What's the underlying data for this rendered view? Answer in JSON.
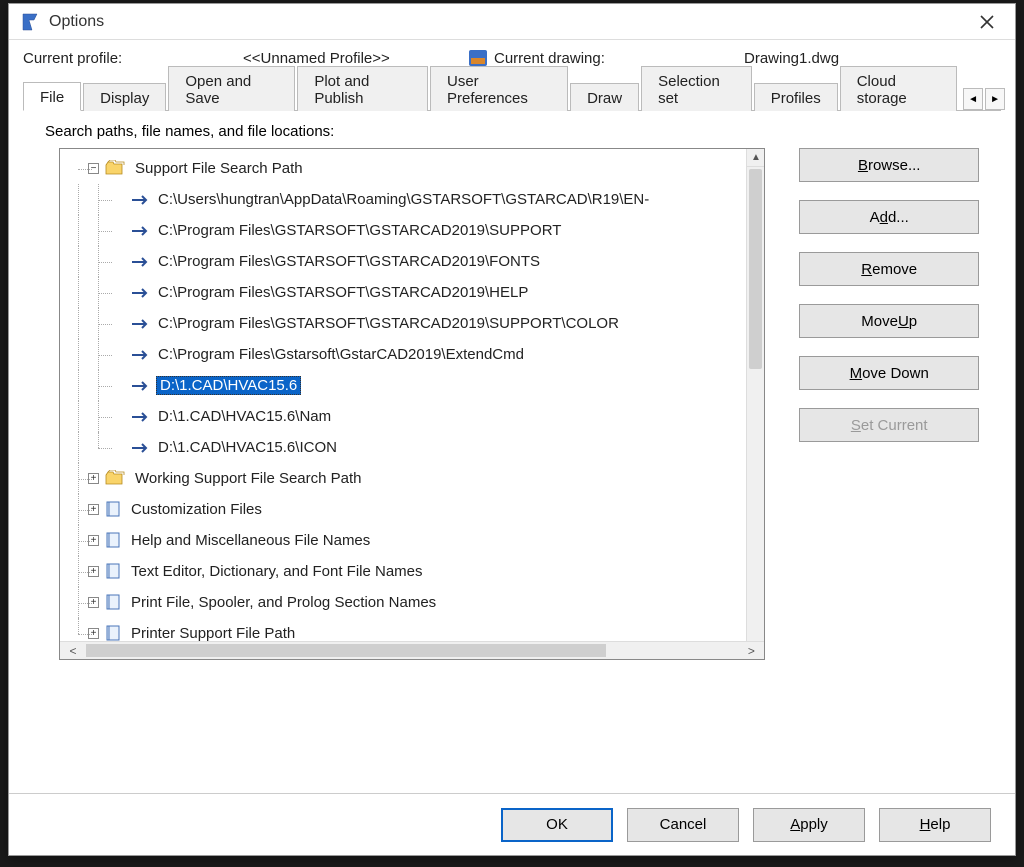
{
  "window": {
    "title": "Options"
  },
  "header": {
    "profile_label": "Current profile:",
    "profile_value": "<<Unnamed Profile>>",
    "drawing_label": "Current drawing:",
    "drawing_value": "Drawing1.dwg"
  },
  "tabs": {
    "items": [
      "File",
      "Display",
      "Open and Save",
      "Plot and Publish",
      "User Preferences",
      "Draw",
      "Selection set",
      "Profiles",
      "Cloud storage"
    ],
    "active": "File"
  },
  "panel": {
    "label": "Search paths, file names, and file locations:"
  },
  "tree": {
    "root0": {
      "label": "Support File Search Path",
      "children": [
        "C:\\Users\\hungtran\\AppData\\Roaming\\GSTARSOFT\\GSTARCAD\\R19\\EN-",
        "C:\\Program Files\\GSTARSOFT\\GSTARCAD2019\\SUPPORT",
        "C:\\Program Files\\GSTARSOFT\\GSTARCAD2019\\FONTS",
        "C:\\Program Files\\GSTARSOFT\\GSTARCAD2019\\HELP",
        "C:\\Program Files\\GSTARSOFT\\GSTARCAD2019\\SUPPORT\\COLOR",
        "C:\\Program Files\\Gstarsoft\\GstarCAD2019\\ExtendCmd",
        "D:\\1.CAD\\HVAC15.6",
        "D:\\1.CAD\\HVAC15.6\\Nam",
        "D:\\1.CAD\\HVAC15.6\\ICON"
      ],
      "selected_index": 6
    },
    "siblings": [
      "Working Support File Search Path",
      "Customization Files",
      "Help and Miscellaneous File Names",
      "Text Editor, Dictionary, and Font File Names",
      "Print File, Spooler, and Prolog Section Names",
      "Printer Support File Path"
    ]
  },
  "side_buttons": {
    "browse": "Browse...",
    "browse_html": "<u>B</u>rowse...",
    "add": "Add...",
    "add_html": "A<u>d</u>d...",
    "remove": "Remove",
    "remove_html": "<u>R</u>emove",
    "move_up": "Move Up",
    "move_up_html": "Move <u>U</u>p",
    "move_down": "Move Down",
    "move_down_html": "<u>M</u>ove Down",
    "set_current": "Set Current",
    "set_current_html": "<u>S</u>et Current"
  },
  "bottom": {
    "ok": "OK",
    "cancel": "Cancel",
    "apply": "Apply",
    "apply_html": "<u>A</u>pply",
    "help": "Help",
    "help_html": "<u>H</u>elp"
  }
}
